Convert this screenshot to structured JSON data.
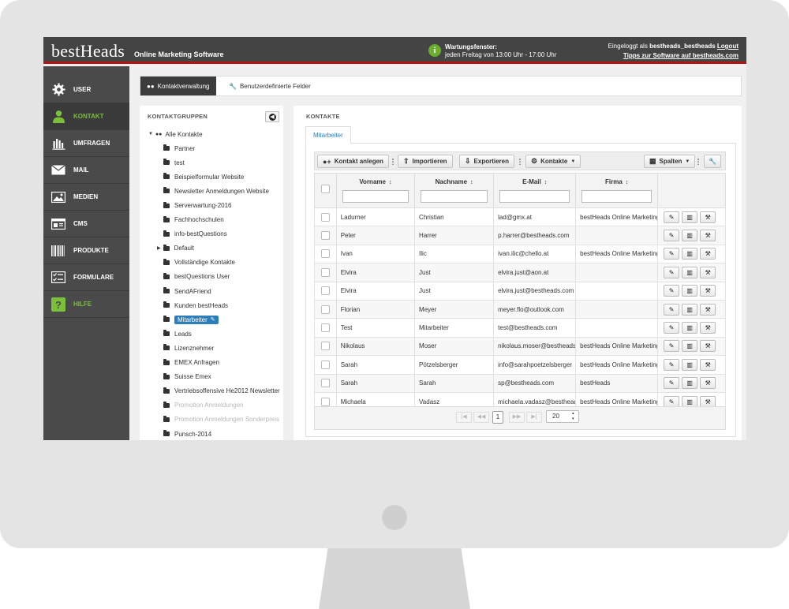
{
  "header": {
    "logo": "bestHeads",
    "subtitle": "Online Marketing Software",
    "maintenance_title": "Wartungsfenster:",
    "maintenance_text": "jeden Freitag von 13:00 Uhr - 17:00 Uhr",
    "login_prefix": "Eingeloggt als",
    "login_user": "bestheads_bestheads",
    "logout": "Logout",
    "tips": "Tipps zur Software auf bestheads.com"
  },
  "sidebar": {
    "items": [
      {
        "label": "USER",
        "icon": "gear-icon"
      },
      {
        "label": "KONTAKT",
        "icon": "person-icon"
      },
      {
        "label": "UMFRAGEN",
        "icon": "bar-chart-icon"
      },
      {
        "label": "MAIL",
        "icon": "envelope-icon"
      },
      {
        "label": "MEDIEN",
        "icon": "image-icon"
      },
      {
        "label": "CMS",
        "icon": "window-icon"
      },
      {
        "label": "PRODUKTE",
        "icon": "barcode-icon"
      },
      {
        "label": "FORMULARE",
        "icon": "checklist-icon"
      },
      {
        "label": "HILFE",
        "icon": "help-icon"
      }
    ],
    "active": "KONTAKT"
  },
  "tabs": {
    "active": "Kontaktverwaltung",
    "second": "Benutzerdefinierte Felder"
  },
  "groups": {
    "title": "KONTAKTGRUPPEN",
    "root": "Alle Kontakte",
    "items": [
      "Partner",
      "test",
      "Beispielformular Website",
      "Newsletter Anmeldungen Website",
      "Serverwartung-2016",
      "Fachhochschulen",
      "info-bestQuestions",
      "Default",
      "Vollständige Kontakte",
      "bestQuestions User",
      "SendAFriend",
      "Kunden bestHeads",
      "Mitarbeiter",
      "Leads",
      "Lizenznehmer",
      "EMEX Anfragen",
      "Suisse Emex",
      "Vertriebsoffensive He2012 Newsletter",
      "Promotion Anmeldungen",
      "Promotion Anmeldungen Sonderpreis",
      "Punsch-2014"
    ],
    "selected": "Mitarbeiter",
    "disabled": [
      "Promotion Anmeldungen",
      "Promotion Anmeldungen Sonderpreis"
    ]
  },
  "contacts": {
    "title": "KONTAKTE",
    "subtab": "Mitarbeiter",
    "toolbar": {
      "add": "Kontakt anlegen",
      "import": "Importieren",
      "export": "Exportieren",
      "contacts_menu": "Kontakte",
      "columns": "Spalten"
    },
    "columns": [
      "Vorname",
      "Nachname",
      "E-Mail",
      "Firma"
    ],
    "rows": [
      {
        "vorname": "Ladurner",
        "nachname": "Christian",
        "email": "lad@gmx.at",
        "firma": "bestHeads Online Marketing"
      },
      {
        "vorname": "Peter",
        "nachname": "Harrer",
        "email": "p.harrer@bestheads.com",
        "firma": ""
      },
      {
        "vorname": "Ivan",
        "nachname": "Ilic",
        "email": "ivan.ilic@chello.at",
        "firma": "bestHeads Online Marketing"
      },
      {
        "vorname": "Elvira",
        "nachname": "Just",
        "email": "elvira.just@aon.at",
        "firma": ""
      },
      {
        "vorname": "Elvira",
        "nachname": "Just",
        "email": "elvira.just@bestheads.com",
        "firma": ""
      },
      {
        "vorname": "Florian",
        "nachname": "Meyer",
        "email": "meyer.flo@outlook.com",
        "firma": ""
      },
      {
        "vorname": "Test",
        "nachname": "Mitarbeiter",
        "email": "test@bestheads.com",
        "firma": ""
      },
      {
        "vorname": "Nikolaus",
        "nachname": "Moser",
        "email": "nikolaus.moser@bestheads",
        "firma": "bestHeads Online Marketing"
      },
      {
        "vorname": "Sarah",
        "nachname": "Pötzelsberger",
        "email": "info@sarahpoetzelsberger",
        "firma": "bestHeads Online Marketing"
      },
      {
        "vorname": "Sarah",
        "nachname": "Sarah",
        "email": "sp@bestheads.com",
        "firma": "bestHeads"
      },
      {
        "vorname": "Michaela",
        "nachname": "Vadasz",
        "email": "michaela.vadasz@bestheads",
        "firma": "bestHeads Online Marketing"
      }
    ],
    "pager": {
      "current_page": "1",
      "page_size": "20"
    }
  },
  "colors": {
    "topbar": "#444444",
    "accent_red": "#b31515",
    "accent_green": "#7bbf3a",
    "selected_blue": "#2d7eb8"
  }
}
